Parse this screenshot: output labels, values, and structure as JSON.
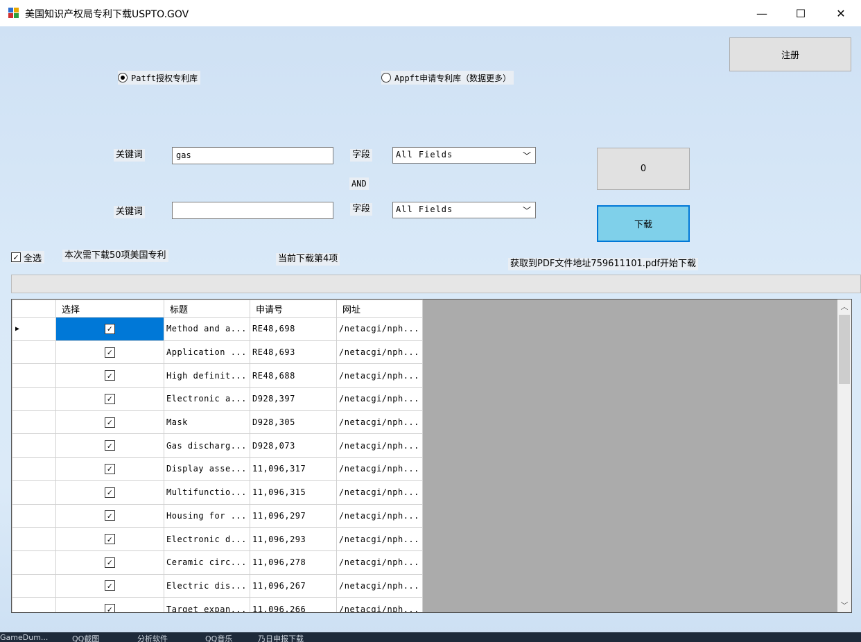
{
  "window": {
    "title": "美国知识产权局专利下载USPTO.GOV",
    "minimize": "—",
    "maximize": "☐",
    "close": "✕"
  },
  "register_button": "注册",
  "databases": [
    {
      "label": "Patft授权专利库",
      "selected": true
    },
    {
      "label": "Appft申请专利库（数据更多）",
      "selected": false
    }
  ],
  "search": {
    "row1": {
      "keyword_label": "关键词",
      "keyword_value": "gas",
      "field_label": "字段",
      "field_value": "All Fields"
    },
    "connector": "AND",
    "row2": {
      "keyword_label": "关键词",
      "keyword_value": "",
      "field_label": "字段",
      "field_value": "All Fields"
    }
  },
  "count_button": "0",
  "download_button": "下载",
  "select_all_label": "全选",
  "status": {
    "total": "本次需下载50项美国专利",
    "current": "当前下载第4项",
    "message": "获取到PDF文件地址759611101.pdf开始下载"
  },
  "progress_percent": 0,
  "grid": {
    "columns": [
      "选择",
      "标题",
      "申请号",
      "网址"
    ],
    "rows": [
      {
        "title": "Method and a...",
        "number": "RE48,698",
        "url": "/netacgi/nph...",
        "checked": true
      },
      {
        "title": "Application ...",
        "number": "RE48,693",
        "url": "/netacgi/nph...",
        "checked": true
      },
      {
        "title": "High definit...",
        "number": "RE48,688",
        "url": "/netacgi/nph...",
        "checked": true
      },
      {
        "title": "Electronic a...",
        "number": "D928,397",
        "url": "/netacgi/nph...",
        "checked": true
      },
      {
        "title": "Mask",
        "number": "D928,305",
        "url": "/netacgi/nph...",
        "checked": true
      },
      {
        "title": "Gas discharg...",
        "number": "D928,073",
        "url": "/netacgi/nph...",
        "checked": true
      },
      {
        "title": "Display asse...",
        "number": "11,096,317",
        "url": "/netacgi/nph...",
        "checked": true
      },
      {
        "title": "Multifunctio...",
        "number": "11,096,315",
        "url": "/netacgi/nph...",
        "checked": true
      },
      {
        "title": "Housing for ...",
        "number": "11,096,297",
        "url": "/netacgi/nph...",
        "checked": true
      },
      {
        "title": "Electronic d...",
        "number": "11,096,293",
        "url": "/netacgi/nph...",
        "checked": true
      },
      {
        "title": "Ceramic circ...",
        "number": "11,096,278",
        "url": "/netacgi/nph...",
        "checked": true
      },
      {
        "title": "Electric dis...",
        "number": "11,096,267",
        "url": "/netacgi/nph...",
        "checked": true
      },
      {
        "title": "Target expan...",
        "number": "11,096,266",
        "url": "/netacgi/nph...",
        "checked": true
      }
    ]
  },
  "taskbar_items": [
    "GameDum...",
    "QQ截图",
    "分析软件",
    "QQ音乐",
    "乃日申报下载"
  ],
  "colors": {
    "accent": "#0078d7",
    "download_button": "#7fd0ea",
    "grid_background": "#ababab"
  }
}
